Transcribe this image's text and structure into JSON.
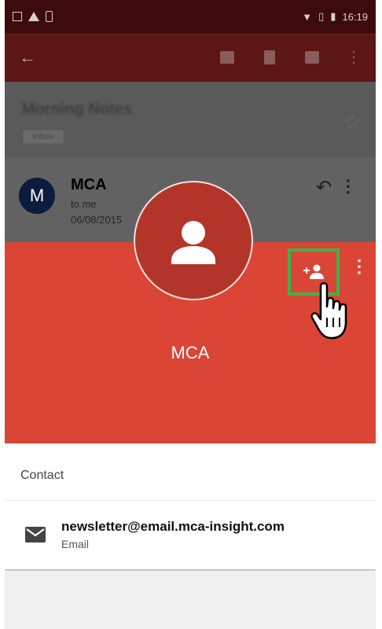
{
  "status_bar": {
    "time": "16:19"
  },
  "email": {
    "subject": "Morning Notes",
    "label": "Inbox",
    "sender_initial": "M",
    "sender_name": "MCA",
    "recipient": "to me",
    "date": "06/08/2015"
  },
  "contact_card": {
    "name": "MCA",
    "section_header": "Contact",
    "email_address": "newsletter@email.mca-insight.com",
    "email_type": "Email"
  },
  "colors": {
    "card_red": "#db4535",
    "highlight_green": "#3db34a",
    "avatar_red": "#b3352a"
  },
  "icons": [
    "back-arrow-icon",
    "archive-icon",
    "delete-icon",
    "mail-icon",
    "more-vert-icon",
    "star-icon",
    "reply-icon",
    "person-icon",
    "add-person-icon",
    "hand-pointer-icon",
    "envelope-icon"
  ]
}
